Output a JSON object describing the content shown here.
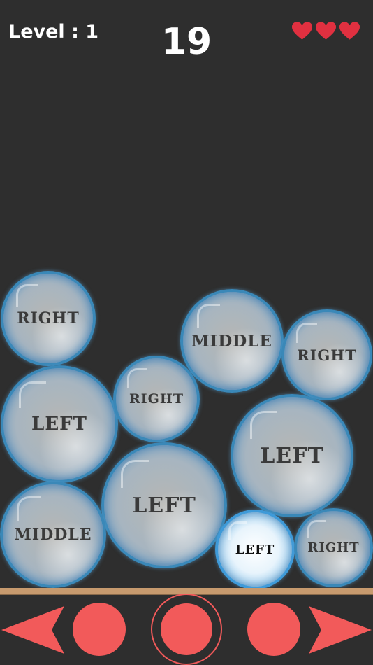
{
  "hud": {
    "level_text": "Level : 1",
    "score": "19",
    "lives": 3,
    "heart_color": "#e03040"
  },
  "bubbles": [
    {
      "label": "RIGHT"
    },
    {
      "label": "MIDDLE"
    },
    {
      "label": "RIGHT"
    },
    {
      "label": "LEFT"
    },
    {
      "label": "RIGHT"
    },
    {
      "label": "LEFT"
    },
    {
      "label": "LEFT"
    },
    {
      "label": "MIDDLE"
    },
    {
      "label": "LEFT"
    },
    {
      "label": "RIGHT"
    }
  ],
  "controls": {
    "accent_color": "#f25a5a",
    "buttons": [
      "move-left",
      "drop-left",
      "drop-middle",
      "drop-right",
      "move-right"
    ]
  }
}
